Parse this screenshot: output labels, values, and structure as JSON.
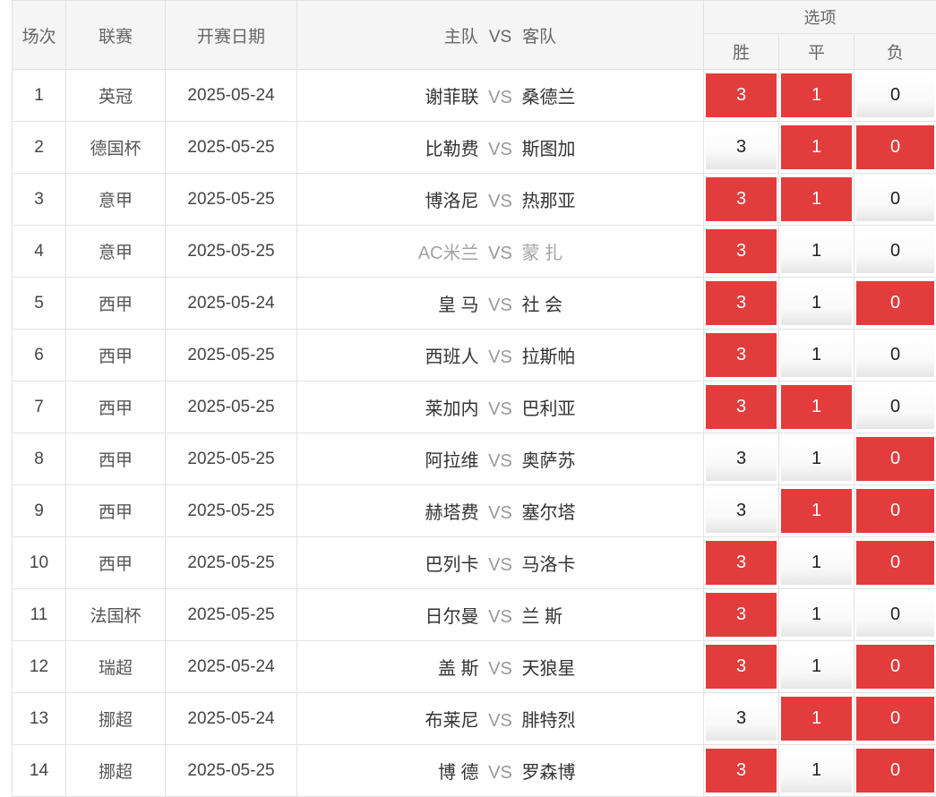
{
  "header": {
    "col_index": "场次",
    "col_league": "联赛",
    "col_date": "开赛日期",
    "col_home": "主队",
    "col_vs": "VS",
    "col_away": "客队",
    "options_group": "选项",
    "opt_win": "胜",
    "opt_draw": "平",
    "opt_lose": "负"
  },
  "vs_label": "VS",
  "colors": {
    "selected": "#e23c3c",
    "header_bg": "#f5f5f5",
    "border": "#e1e1e1"
  },
  "rows": [
    {
      "index": "1",
      "league": "英冠",
      "date": "2025-05-24",
      "home": "谢菲联",
      "away": "桑德兰",
      "muted": false,
      "win": "3",
      "draw": "1",
      "lose": "0",
      "win_sel": true,
      "draw_sel": true,
      "lose_sel": false
    },
    {
      "index": "2",
      "league": "德国杯",
      "date": "2025-05-25",
      "home": "比勒费",
      "away": "斯图加",
      "muted": false,
      "win": "3",
      "draw": "1",
      "lose": "0",
      "win_sel": false,
      "draw_sel": true,
      "lose_sel": true
    },
    {
      "index": "3",
      "league": "意甲",
      "date": "2025-05-25",
      "home": "博洛尼",
      "away": "热那亚",
      "muted": false,
      "win": "3",
      "draw": "1",
      "lose": "0",
      "win_sel": true,
      "draw_sel": true,
      "lose_sel": false
    },
    {
      "index": "4",
      "league": "意甲",
      "date": "2025-05-25",
      "home": "AC米兰",
      "away": "蒙 扎",
      "muted": true,
      "win": "3",
      "draw": "1",
      "lose": "0",
      "win_sel": true,
      "draw_sel": false,
      "lose_sel": false
    },
    {
      "index": "5",
      "league": "西甲",
      "date": "2025-05-24",
      "home": "皇 马",
      "away": "社 会",
      "muted": false,
      "win": "3",
      "draw": "1",
      "lose": "0",
      "win_sel": true,
      "draw_sel": false,
      "lose_sel": true
    },
    {
      "index": "6",
      "league": "西甲",
      "date": "2025-05-25",
      "home": "西班人",
      "away": "拉斯帕",
      "muted": false,
      "win": "3",
      "draw": "1",
      "lose": "0",
      "win_sel": true,
      "draw_sel": false,
      "lose_sel": false
    },
    {
      "index": "7",
      "league": "西甲",
      "date": "2025-05-25",
      "home": "莱加内",
      "away": "巴利亚",
      "muted": false,
      "win": "3",
      "draw": "1",
      "lose": "0",
      "win_sel": true,
      "draw_sel": true,
      "lose_sel": false
    },
    {
      "index": "8",
      "league": "西甲",
      "date": "2025-05-25",
      "home": "阿拉维",
      "away": "奥萨苏",
      "muted": false,
      "win": "3",
      "draw": "1",
      "lose": "0",
      "win_sel": false,
      "draw_sel": false,
      "lose_sel": true
    },
    {
      "index": "9",
      "league": "西甲",
      "date": "2025-05-25",
      "home": "赫塔费",
      "away": "塞尔塔",
      "muted": false,
      "win": "3",
      "draw": "1",
      "lose": "0",
      "win_sel": false,
      "draw_sel": true,
      "lose_sel": true
    },
    {
      "index": "10",
      "league": "西甲",
      "date": "2025-05-25",
      "home": "巴列卡",
      "away": "马洛卡",
      "muted": false,
      "win": "3",
      "draw": "1",
      "lose": "0",
      "win_sel": true,
      "draw_sel": false,
      "lose_sel": true
    },
    {
      "index": "11",
      "league": "法国杯",
      "date": "2025-05-25",
      "home": "日尔曼",
      "away": "兰 斯",
      "muted": false,
      "win": "3",
      "draw": "1",
      "lose": "0",
      "win_sel": true,
      "draw_sel": false,
      "lose_sel": false
    },
    {
      "index": "12",
      "league": "瑞超",
      "date": "2025-05-24",
      "home": "盖 斯",
      "away": "天狼星",
      "muted": false,
      "win": "3",
      "draw": "1",
      "lose": "0",
      "win_sel": true,
      "draw_sel": false,
      "lose_sel": true
    },
    {
      "index": "13",
      "league": "挪超",
      "date": "2025-05-24",
      "home": "布莱尼",
      "away": "腓特烈",
      "muted": false,
      "win": "3",
      "draw": "1",
      "lose": "0",
      "win_sel": false,
      "draw_sel": true,
      "lose_sel": true
    },
    {
      "index": "14",
      "league": "挪超",
      "date": "2025-05-25",
      "home": "博 德",
      "away": "罗森博",
      "muted": false,
      "win": "3",
      "draw": "1",
      "lose": "0",
      "win_sel": true,
      "draw_sel": false,
      "lose_sel": true
    }
  ]
}
